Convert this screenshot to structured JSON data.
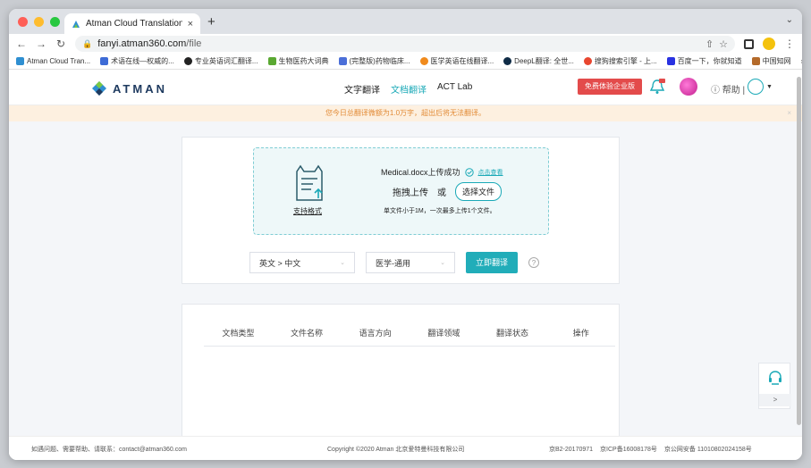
{
  "browser": {
    "tab_title": "Atman Cloud Translation",
    "tab_close": "×",
    "new_tab": "+",
    "url_host": "fanyi.atman360.com",
    "url_path": "/file",
    "bookmarks": [
      {
        "label": "Atman Cloud Tran...",
        "color": "#2f8fd1"
      },
      {
        "label": "术语在线—权威的...",
        "color": "#3d6bd6"
      },
      {
        "label": "专业英语词汇翻译...",
        "color": "#222222"
      },
      {
        "label": "生物医药大词典",
        "color": "#5aa832"
      },
      {
        "label": "(完整版)药物临床...",
        "color": "#4b6fd8"
      },
      {
        "label": "医学英语在线翻译...",
        "color": "#f08a1c"
      },
      {
        "label": "DeepL翻译: 全世...",
        "color": "#0f2b46"
      },
      {
        "label": "搜狗搜索引擎 - 上...",
        "color": "#e8462f"
      },
      {
        "label": "百度一下，你就知道",
        "color": "#2932e1"
      },
      {
        "label": "中国知网",
        "color": "#b46a2a"
      }
    ],
    "bookmarks_more": "»"
  },
  "header": {
    "logo_text": "ATMAN",
    "nav": [
      "文字翻译",
      "文档翻译",
      "ACT Lab"
    ],
    "trial_button": "免费体验企业版",
    "help": "帮助",
    "accent_color": "#1aa9b7"
  },
  "notice": {
    "text": "您今日总翻译微额为1.0万字，超出后将无法翻译。",
    "close": "×"
  },
  "upload": {
    "formats_link": "支持格式",
    "status_text": "Medical.docx上传成功",
    "view_link": "点击查看",
    "drag_text": "拖拽上传",
    "or_text": "或",
    "choose_button": "选择文件",
    "limit_text": "单文件小于1M，一次最多上传1个文件。"
  },
  "controls": {
    "direction": "英文 > 中文",
    "domain": "医学-通用",
    "translate_button": "立即翻译",
    "help_icon": "?"
  },
  "table": {
    "headers": [
      "文档类型",
      "文件名称",
      "语言方向",
      "翻译领域",
      "翻译状态",
      "操作"
    ]
  },
  "footer": {
    "contact": "如遇问题、需要帮助、请联系：contact@atman360.com",
    "copyright": "Copyright ©2020 Atman   北京爱特曼科技有限公司",
    "icp1": "京B2-20170971",
    "icp2": "京ICP备16008178号",
    "icp3": "京公网安备 11010802024158号"
  },
  "sidewidget": {
    "arrow": ">"
  }
}
